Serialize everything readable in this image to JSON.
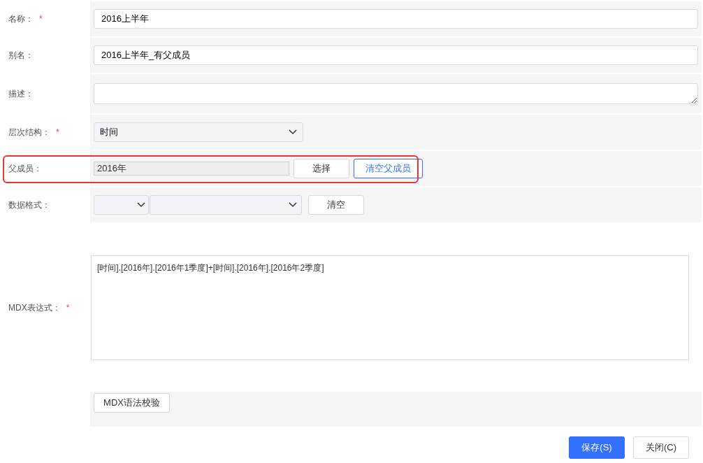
{
  "fields": [
    {
      "kind": "text",
      "label": "名称：",
      "required_mark": "*",
      "value": "2016上半年"
    },
    {
      "kind": "text",
      "label": "别名：",
      "value": "2016上半年_有父成员"
    },
    {
      "kind": "textarea",
      "label": "描述："
    },
    {
      "kind": "select",
      "label": "层次结构：",
      "required_mark": "*",
      "value": "时间"
    },
    {
      "kind": "parent",
      "label": "父成员：",
      "value": "2016年",
      "highlighted": true,
      "buttons": [
        {
          "label": "选择",
          "primary_outline": false
        },
        {
          "label": "清空父成员",
          "primary_outline": true
        }
      ]
    },
    {
      "kind": "format",
      "label": "数据格式：",
      "button": "清空"
    }
  ],
  "mdx": {
    "label": "MDX表达式：",
    "required_mark": "*",
    "value": "[时间].[2016年].[2016年1季度]+[时间].[2016年].[2016年2季度]",
    "check_button": "MDX语法校验"
  },
  "footer": {
    "save": "保存(S)",
    "close": "关闭(C)"
  }
}
